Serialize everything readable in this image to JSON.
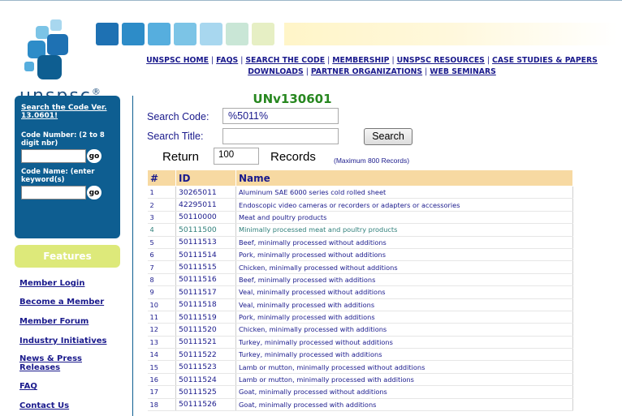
{
  "brand": {
    "name": "unspsc",
    "registered": "®",
    "colors": {
      "primary": "#0e5e91",
      "accent_green": "#27871f",
      "header_row": "#f7d9a2",
      "features_bg": "#dde97a"
    }
  },
  "topnav": {
    "row1": [
      "UNSPSC HOME",
      "FAQS",
      "SEARCH THE CODE",
      "MEMBERSHIP",
      "UNSPSC RESOURCES",
      "CASE STUDIES & PAPERS"
    ],
    "row2": [
      "DOWNLOADS",
      "PARTNER ORGANIZATIONS",
      "WEB SEMINARS"
    ],
    "separator": "|"
  },
  "sidebar": {
    "search_link": "Search the Code Ver. 13.0601!",
    "code_number_label": "Code Number: (2 to 8 digit nbr)",
    "code_name_label": "Code Name: (enter keyword(s)",
    "go_label": "go",
    "features_label": "Features",
    "links": [
      "Member Login",
      "Become a Member",
      "Member Forum",
      "Industry Initiatives",
      "News & Press Releases",
      "FAQ",
      "Contact Us"
    ]
  },
  "search": {
    "version_title": "UNv130601",
    "code_label": "Search Code:",
    "code_value": "%5011%",
    "title_label": "Search Title:",
    "title_value": "",
    "button_label": "Search",
    "return_label": "Return",
    "return_value": "100",
    "records_label": "Records",
    "max_note": "(Maximum 800 Records)"
  },
  "table": {
    "headers": [
      "#",
      "ID",
      "Name"
    ],
    "rows": [
      {
        "n": "1",
        "id": "30265011",
        "name": "Aluminum SAE 6000 series cold rolled sheet",
        "hl": false
      },
      {
        "n": "2",
        "id": "42295011",
        "name": "Endoscopic video cameras or recorders or adapters or accessories",
        "hl": false
      },
      {
        "n": "3",
        "id": "50110000",
        "name": "Meat and poultry products",
        "hl": false
      },
      {
        "n": "4",
        "id": "50111500",
        "name": "Minimally processed meat and poultry products",
        "hl": true
      },
      {
        "n": "5",
        "id": "50111513",
        "name": "Beef, minimally processed without additions",
        "hl": false
      },
      {
        "n": "6",
        "id": "50111514",
        "name": "Pork, minimally processed without additions",
        "hl": false
      },
      {
        "n": "7",
        "id": "50111515",
        "name": "Chicken, minimally processed without additions",
        "hl": false
      },
      {
        "n": "8",
        "id": "50111516",
        "name": "Beef, minimally processed with additions",
        "hl": false
      },
      {
        "n": "9",
        "id": "50111517",
        "name": "Veal, minimally processed without additions",
        "hl": false
      },
      {
        "n": "10",
        "id": "50111518",
        "name": "Veal, minimally processed with additions",
        "hl": false
      },
      {
        "n": "11",
        "id": "50111519",
        "name": "Pork, minimally processed with additions",
        "hl": false
      },
      {
        "n": "12",
        "id": "50111520",
        "name": "Chicken, minimally processed with additions",
        "hl": false
      },
      {
        "n": "13",
        "id": "50111521",
        "name": "Turkey, minimally processed without additions",
        "hl": false
      },
      {
        "n": "14",
        "id": "50111522",
        "name": "Turkey, minimally processed with additions",
        "hl": false
      },
      {
        "n": "15",
        "id": "50111523",
        "name": "Lamb or mutton, minimally processed without additions",
        "hl": false
      },
      {
        "n": "16",
        "id": "50111524",
        "name": "Lamb or mutton, minimally processed with additions",
        "hl": false
      },
      {
        "n": "17",
        "id": "50111525",
        "name": "Goat, minimally processed without additions",
        "hl": false
      },
      {
        "n": "18",
        "id": "50111526",
        "name": "Goat, minimally processed with additions",
        "hl": false
      }
    ]
  }
}
